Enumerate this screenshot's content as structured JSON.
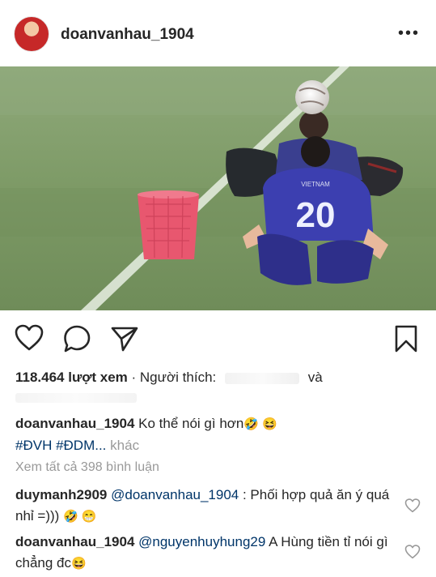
{
  "header": {
    "username": "doanvanhau_1904",
    "more_label": "•••"
  },
  "photo": {
    "jersey_number": "20",
    "jersey_text": "VIETNAM"
  },
  "stats": {
    "views": "118.464 lượt xem",
    "sep": "·",
    "liked_by_label": "Người thích:",
    "and_label": "và"
  },
  "caption": {
    "username": "doanvanhau_1904",
    "text": "Ko thể nói gì hơn",
    "emoji": "🤣 😆",
    "hashtags": "#ĐVH #ĐDM...",
    "more": "khác"
  },
  "view_all": "Xem tất cả 398 bình luận",
  "comments": [
    {
      "username": "duymanh2909",
      "mention": "@doanvanhau_1904",
      "text": ": Phối hợp quả ăn ý quá nhỉ =)))",
      "emoji": "🤣 😁"
    },
    {
      "username": "doanvanhau_1904",
      "mention": "@nguyenhuyhung29",
      "text": "A Hùng tiền tỉ nói gì chẳng đc",
      "emoji": "😆"
    }
  ],
  "icons": {
    "like": "heart-icon",
    "comment": "comment-icon",
    "share": "send-icon",
    "save": "bookmark-icon"
  }
}
